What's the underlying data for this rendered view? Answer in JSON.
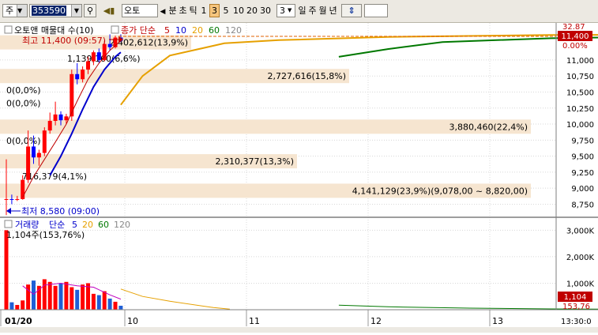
{
  "toolbar": {
    "market": "주",
    "code": "353590",
    "name": "오토",
    "units": [
      "분",
      "초",
      "틱"
    ],
    "intervals": [
      "1",
      "3",
      "5",
      "10",
      "20",
      "30"
    ],
    "count": "3",
    "periods": [
      "일",
      "주",
      "월",
      "년"
    ]
  },
  "price_panel": {
    "legend": {
      "title": "오토앤 매물대 수(10)",
      "ma_label": "종가 단순",
      "ma_periods": [
        "5",
        "10",
        "20",
        "60",
        "120"
      ],
      "colors": [
        "#c00000",
        "#0000cc",
        "#e6a000",
        "#007800",
        "#888888"
      ]
    },
    "high_label": "최고 11,400 (09:57)",
    "low_label": "최저 8,580 (09:00)",
    "current_price": "11,400",
    "current_change": "0.00%",
    "top_axis_text": "32.87",
    "volume_profile": [
      {
        "label": "2,402,612(13,9%)",
        "price": 11275
      },
      {
        "label": "2,727,616(15,8%)",
        "price": 10750
      },
      {
        "label": "3,880,460(22,4%)",
        "price": 9960
      },
      {
        "label": "2,310,377(13,3%)",
        "price": 9420
      },
      {
        "label": "4,141,129(23,9%)(9,078,00 ~ 8,820,00)",
        "price": 8960
      }
    ],
    "small_labels": [
      {
        "label": "0(0,0%)",
        "price": 10530
      },
      {
        "label": "0(0,0%)",
        "price": 10330
      },
      {
        "label": "0(0,0%)",
        "price": 9740
      },
      {
        "label": "1,139,160(6,6%)",
        "price": 11025
      },
      {
        "label": "716,379(4,1%)",
        "price": 9190
      }
    ]
  },
  "volume_panel": {
    "legend": {
      "title": "거래량",
      "ma_label": "단순",
      "ma_periods": [
        "5",
        "20",
        "60",
        "120"
      ],
      "colors": [
        "#0000cc",
        "#e6a000",
        "#007800",
        "#888888"
      ],
      "current_text": "1,104주(153,76%)"
    },
    "current_value": "1,104",
    "current_pct": "153,76"
  },
  "x_axis": {
    "labels": [
      "01/20",
      "10",
      "11",
      "12",
      "13",
      "13:30:0"
    ]
  },
  "chart_data": {
    "type": "candlestick",
    "price_axis": {
      "ticks": [
        "11,000",
        "10,750",
        "10,500",
        "10,250",
        "10,000",
        "9,750",
        "9,500",
        "9,250",
        "9,000",
        "8,750"
      ],
      "values": [
        11000,
        10750,
        10500,
        10250,
        10000,
        9750,
        9500,
        9250,
        9000,
        8750
      ],
      "range": [
        8620,
        11480
      ]
    },
    "volume_axis": {
      "ticks": [
        "3,000K",
        "2,000K",
        "1,000K"
      ],
      "values": [
        3000000,
        2000000,
        1000000
      ],
      "range": [
        0,
        3100000
      ]
    },
    "time_labels": [
      "10",
      "11",
      "12",
      "13"
    ],
    "candles": [
      {
        "o": 8820,
        "h": 9450,
        "l": 8580,
        "c": 8830
      },
      {
        "o": 8830,
        "h": 8900,
        "l": 8750,
        "c": 8820
      },
      {
        "o": 8820,
        "h": 8880,
        "l": 8800,
        "c": 8830
      },
      {
        "o": 8830,
        "h": 9200,
        "l": 8820,
        "c": 9130
      },
      {
        "o": 9130,
        "h": 9900,
        "l": 9080,
        "c": 9650
      },
      {
        "o": 9650,
        "h": 9820,
        "l": 9380,
        "c": 9480
      },
      {
        "o": 9480,
        "h": 9600,
        "l": 9350,
        "c": 9550
      },
      {
        "o": 9550,
        "h": 9950,
        "l": 9500,
        "c": 9900
      },
      {
        "o": 9900,
        "h": 10180,
        "l": 9850,
        "c": 10050
      },
      {
        "o": 10050,
        "h": 10350,
        "l": 9980,
        "c": 10150
      },
      {
        "o": 10150,
        "h": 10200,
        "l": 9980,
        "c": 10060
      },
      {
        "o": 10060,
        "h": 10160,
        "l": 10000,
        "c": 10120
      },
      {
        "o": 10120,
        "h": 10850,
        "l": 10050,
        "c": 10780
      },
      {
        "o": 10780,
        "h": 10950,
        "l": 10620,
        "c": 10700
      },
      {
        "o": 10700,
        "h": 10900,
        "l": 10650,
        "c": 10850
      },
      {
        "o": 10850,
        "h": 11050,
        "l": 10780,
        "c": 10980
      },
      {
        "o": 10980,
        "h": 11150,
        "l": 10920,
        "c": 11120
      },
      {
        "o": 11120,
        "h": 11180,
        "l": 10950,
        "c": 11000
      },
      {
        "o": 11000,
        "h": 11300,
        "l": 10980,
        "c": 11250
      },
      {
        "o": 11250,
        "h": 11400,
        "l": 11150,
        "c": 11200
      },
      {
        "o": 11200,
        "h": 11380,
        "l": 11180,
        "c": 11350
      },
      {
        "o": 11350,
        "h": 11400,
        "l": 11280,
        "c": 11300
      }
    ],
    "volumes": [
      3000000,
      280000,
      180000,
      350000,
      950000,
      1100000,
      900000,
      1150000,
      1050000,
      900000,
      1000000,
      1050000,
      850000,
      750000,
      950000,
      1000000,
      600000,
      550000,
      700000,
      420000,
      300000,
      150000
    ],
    "ma_price": [
      {
        "name": "5",
        "values": [
          {
            "i": 3,
            "v": 8860
          },
          {
            "i": 5,
            "v": 9180
          },
          {
            "i": 7,
            "v": 9450
          },
          {
            "i": 9,
            "v": 9720
          },
          {
            "i": 11,
            "v": 10000
          },
          {
            "i": 13,
            "v": 10360
          },
          {
            "i": 15,
            "v": 10700
          },
          {
            "i": 17,
            "v": 10950
          },
          {
            "i": 19,
            "v": 11150
          },
          {
            "i": 21,
            "v": 11300
          }
        ]
      },
      {
        "name": "10",
        "values": [
          {
            "i": 8,
            "v": 9200
          },
          {
            "i": 10,
            "v": 9500
          },
          {
            "i": 12,
            "v": 9850
          },
          {
            "i": 14,
            "v": 10230
          },
          {
            "i": 16,
            "v": 10580
          },
          {
            "i": 18,
            "v": 10850
          },
          {
            "i": 20,
            "v": 11050
          },
          {
            "i": 21,
            "v": 11120
          }
        ]
      },
      {
        "name": "20",
        "values": [
          {
            "i": 21,
            "v": 10300
          },
          {
            "i": 25,
            "v": 10750
          },
          {
            "i": 30,
            "v": 11070
          },
          {
            "i": 40,
            "v": 11260
          },
          {
            "i": 50,
            "v": 11310
          },
          {
            "i": 70,
            "v": 11360
          },
          {
            "i": 100,
            "v": 11390
          },
          {
            "i": 150,
            "v": 11400
          },
          {
            "i": 197,
            "v": 11400
          }
        ]
      },
      {
        "name": "60",
        "values": [
          {
            "i": 61,
            "v": 11050
          },
          {
            "i": 70,
            "v": 11170
          },
          {
            "i": 80,
            "v": 11280
          },
          {
            "i": 100,
            "v": 11340
          },
          {
            "i": 130,
            "v": 11380
          },
          {
            "i": 160,
            "v": 11395
          },
          {
            "i": 197,
            "v": 11400
          }
        ]
      }
    ],
    "ma_volume": [
      {
        "name": "5",
        "values": [
          {
            "i": 3,
            "v": 900000
          },
          {
            "i": 5,
            "v": 580000
          },
          {
            "i": 7,
            "v": 930000
          },
          {
            "i": 10,
            "v": 1000000
          },
          {
            "i": 13,
            "v": 900000
          },
          {
            "i": 16,
            "v": 850000
          },
          {
            "i": 19,
            "v": 560000
          },
          {
            "i": 21,
            "v": 400000
          }
        ]
      },
      {
        "name": "20",
        "values": [
          {
            "i": 21,
            "v": 780000
          },
          {
            "i": 25,
            "v": 500000
          },
          {
            "i": 30,
            "v": 320000
          },
          {
            "i": 38,
            "v": 80000
          },
          {
            "i": 41,
            "v": 20000
          }
        ]
      },
      {
        "name": "60",
        "values": [
          {
            "i": 61,
            "v": 170000
          },
          {
            "i": 70,
            "v": 110000
          },
          {
            "i": 85,
            "v": 60000
          },
          {
            "i": 100,
            "v": 30000
          },
          {
            "i": 120,
            "v": 10000
          }
        ]
      }
    ]
  }
}
